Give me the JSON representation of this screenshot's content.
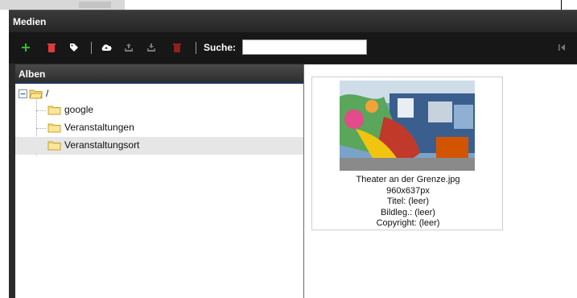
{
  "window": {
    "title": "Medien"
  },
  "toolbar": {
    "buttons": [
      {
        "name": "add-icon",
        "color": "#2fbf2f"
      },
      {
        "name": "trash-icon",
        "color": "#e23b3b"
      },
      {
        "name": "tag-icon",
        "color": "#ffffff"
      },
      {
        "name": "cloud-upload-icon",
        "color": "#ffffff"
      },
      {
        "name": "upload-icon",
        "color": "#7a7a7a"
      },
      {
        "name": "download-icon",
        "color": "#7a7a7a"
      },
      {
        "name": "trash-icon-disabled",
        "color": "#8e2020"
      }
    ],
    "search_label": "Suche:",
    "search_value": "",
    "search_placeholder": ""
  },
  "albums": {
    "header": "Alben",
    "tree": [
      {
        "label": "/",
        "level": 0,
        "expanded": true
      },
      {
        "label": "google",
        "level": 1
      },
      {
        "label": "Veranstaltungen",
        "level": 1
      },
      {
        "label": "Veranstaltungsort",
        "level": 1,
        "selected": true
      }
    ]
  },
  "media": {
    "items": [
      {
        "filename": "Theater an der Grenze.jpg",
        "dimensions": "960x637px",
        "title": "Titel: (leer)",
        "caption": "Bildleg.: (leer)",
        "copyright": "Copyright: (leer)"
      }
    ]
  },
  "colors": {
    "accent": "#1e3a5c",
    "toolbar_bg": "#171717",
    "selected_row": "#e6e6e6"
  }
}
